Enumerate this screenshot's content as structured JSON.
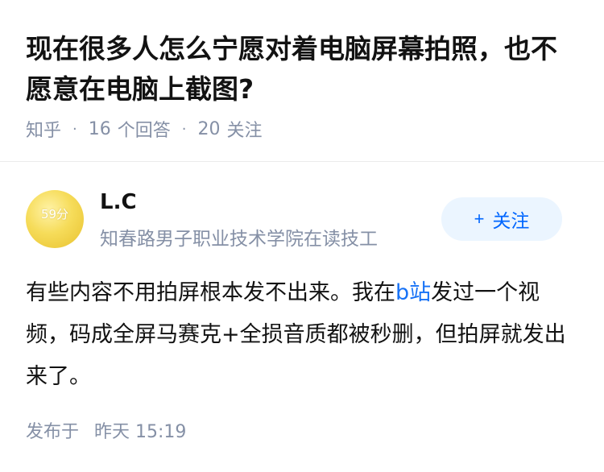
{
  "question": {
    "title": "现在很多人怎么宁愿对着电脑屏幕拍照，也不愿意在电脑上截图?",
    "source": "知乎",
    "answers_count": "16",
    "answers_label": "个回答",
    "followers_count": "20",
    "followers_label": "关注"
  },
  "author": {
    "avatar_score": "59分",
    "name": "L.C",
    "bio": "知春路男子职业技术学院在读技工",
    "follow_plus": "+",
    "follow_label": "关注"
  },
  "answer": {
    "text_before": "有些内容不用拍屏根本发不出来。我在",
    "link_text": "b站",
    "text_after": "发过一个视频，码成全屏马赛克+全损音质都被秒删，但拍屏就发出来了。"
  },
  "publish": {
    "label": "发布于",
    "time": "昨天 15:19"
  },
  "colors": {
    "meta_gray": "#8590a6",
    "accent_blue": "#0066ff",
    "link_blue": "#1772f6",
    "follow_bg": "#ebf5ff"
  }
}
